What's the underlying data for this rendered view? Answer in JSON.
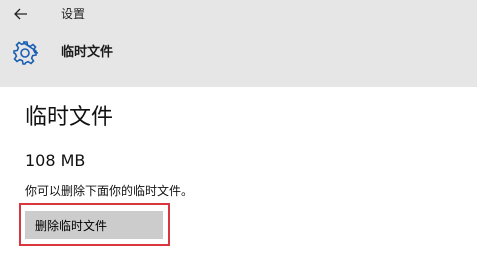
{
  "titlebar": {
    "back_icon": "arrow-left-icon",
    "title": "设置"
  },
  "page_header": {
    "icon": "gear-icon",
    "accent_color": "#1a5fb4",
    "title": "临时文件"
  },
  "content": {
    "section_title": "临时文件",
    "size": "108 MB",
    "description": "你可以删除下面你的临时文件。",
    "delete_button_label": "删除临时文件"
  },
  "highlight": {
    "color": "#d9363e"
  }
}
